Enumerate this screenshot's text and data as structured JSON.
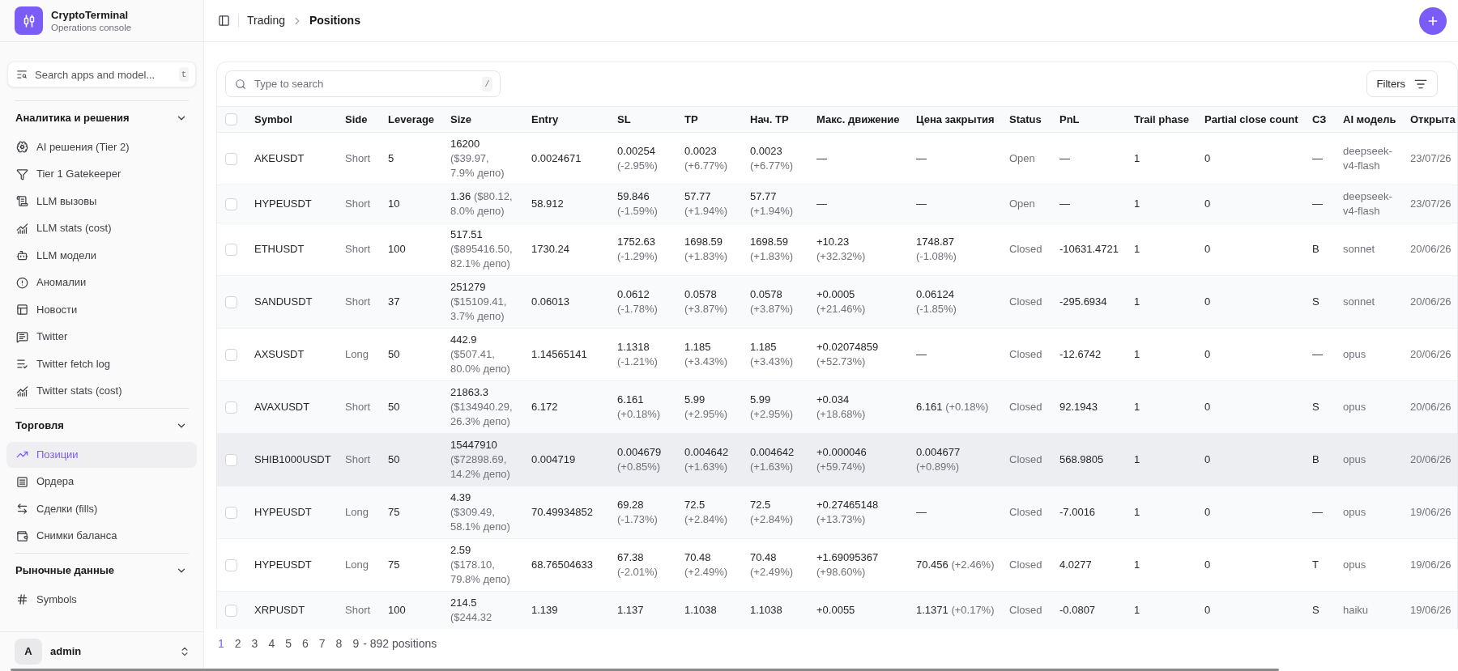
{
  "sidebar": {
    "brand": {
      "title": "CryptoTerminal",
      "subtitle": "Operations console"
    },
    "search": {
      "placeholder": "Search apps and model...",
      "shortcut": "t"
    },
    "sections": [
      {
        "title": "Аналитика и решения",
        "expanded": true,
        "items": [
          {
            "label": "AI решения (Tier 2)",
            "selected": false
          },
          {
            "label": "Tier 1 Gatekeeper",
            "selected": false
          },
          {
            "label": "LLM вызовы",
            "selected": false
          },
          {
            "label": "LLM stats (cost)",
            "selected": false
          },
          {
            "label": "LLM модели",
            "selected": false
          },
          {
            "label": "Аномалии",
            "selected": false
          },
          {
            "label": "Новости",
            "selected": false
          },
          {
            "label": "Twitter",
            "selected": false
          },
          {
            "label": "Twitter fetch log",
            "selected": false
          },
          {
            "label": "Twitter stats (cost)",
            "selected": false
          }
        ]
      },
      {
        "title": "Торговля",
        "expanded": true,
        "items": [
          {
            "label": "Позиции",
            "selected": true
          },
          {
            "label": "Ордера",
            "selected": false
          },
          {
            "label": "Сделки (fills)",
            "selected": false
          },
          {
            "label": "Снимки баланса",
            "selected": false
          }
        ]
      },
      {
        "title": "Рыночные данные",
        "expanded": true,
        "items": [
          {
            "label": "Symbols",
            "selected": false
          }
        ]
      }
    ],
    "user": {
      "initial": "A",
      "name": "admin"
    }
  },
  "header": {
    "breadcrumb": [
      "Trading",
      "Positions"
    ]
  },
  "toolbar": {
    "search": {
      "placeholder": "Type to search",
      "shortcut": "/"
    },
    "filters_button": "Filters"
  },
  "table": {
    "select_all": {
      "checked": false
    },
    "columns": [
      "Symbol",
      "Side",
      "Leverage",
      "Size",
      "Entry",
      "SL",
      "TP",
      "Нач. TP",
      "Макс. движение",
      "Цена закрытия",
      "Status",
      "PnL",
      "Trail phase",
      "Partial close count",
      "СЗ",
      "AI модель",
      "Открыта"
    ],
    "rows": [
      {
        "checked": false,
        "highlighted": false,
        "symbol": "AKEUSDT",
        "side": "Short",
        "leverage": "5",
        "size": {
          "value": "16200",
          "detail": "($39.97, 7.9% депо)"
        },
        "entry": "0.0024671",
        "sl": {
          "value": "0.00254",
          "detail": "(-2.95%)"
        },
        "tp": {
          "value": "0.0023",
          "detail": "(+6.77%)"
        },
        "initial_tp": {
          "value": "0.0023",
          "detail": "(+6.77%)"
        },
        "max_move": {
          "value": "—"
        },
        "close_price": {
          "value": "—"
        },
        "status": "Open",
        "pnl": "—",
        "trail_phase": "1",
        "partial_close_count": "0",
        "sz": "—",
        "ai_model": "deepseek-v4-flash",
        "opened": "23/07/26"
      },
      {
        "checked": false,
        "highlighted": false,
        "symbol": "HYPEUSDT",
        "side": "Short",
        "leverage": "10",
        "size": {
          "value": "1.36",
          "detail": "($80.12, 8.0% депо)"
        },
        "entry": "58.912",
        "sl": {
          "value": "59.846",
          "detail": "(-1.59%)"
        },
        "tp": {
          "value": "57.77",
          "detail": "(+1.94%)"
        },
        "initial_tp": {
          "value": "57.77",
          "detail": "(+1.94%)"
        },
        "max_move": {
          "value": "—"
        },
        "close_price": {
          "value": "—"
        },
        "status": "Open",
        "pnl": "—",
        "trail_phase": "1",
        "partial_close_count": "0",
        "sz": "—",
        "ai_model": "deepseek-v4-flash",
        "opened": "23/07/26"
      },
      {
        "checked": false,
        "highlighted": false,
        "symbol": "ETHUSDT",
        "side": "Short",
        "leverage": "100",
        "size": {
          "value": "517.51",
          "detail": "($895416.50, 82.1% депо)"
        },
        "entry": "1730.24",
        "sl": {
          "value": "1752.63",
          "detail": "(-1.29%)"
        },
        "tp": {
          "value": "1698.59",
          "detail": "(+1.83%)"
        },
        "initial_tp": {
          "value": "1698.59",
          "detail": "(+1.83%)"
        },
        "max_move": {
          "value": "+10.23",
          "detail": "(+32.32%)"
        },
        "close_price": {
          "value": "1748.87",
          "detail": "(-1.08%)"
        },
        "status": "Closed",
        "pnl": "-10631.4721",
        "trail_phase": "1",
        "partial_close_count": "0",
        "sz": "B",
        "ai_model": "sonnet",
        "opened": "20/06/26"
      },
      {
        "checked": false,
        "highlighted": false,
        "symbol": "SANDUSDT",
        "side": "Short",
        "leverage": "37",
        "size": {
          "value": "251279",
          "detail": "($15109.41, 3.7% депо)"
        },
        "entry": "0.06013",
        "sl": {
          "value": "0.0612",
          "detail": "(-1.78%)"
        },
        "tp": {
          "value": "0.0578",
          "detail": "(+3.87%)"
        },
        "initial_tp": {
          "value": "0.0578",
          "detail": "(+3.87%)"
        },
        "max_move": {
          "value": "+0.0005",
          "detail": "(+21.46%)"
        },
        "close_price": {
          "value": "0.06124",
          "detail": "(-1.85%)"
        },
        "status": "Closed",
        "pnl": "-295.6934",
        "trail_phase": "1",
        "partial_close_count": "0",
        "sz": "S",
        "ai_model": "sonnet",
        "opened": "20/06/26"
      },
      {
        "checked": false,
        "highlighted": false,
        "symbol": "AXSUSDT",
        "side": "Long",
        "leverage": "50",
        "size": {
          "value": "442.9",
          "detail": "($507.41, 80.0% депо)"
        },
        "entry": "1.14565141",
        "sl": {
          "value": "1.1318",
          "detail": "(-1.21%)"
        },
        "tp": {
          "value": "1.185",
          "detail": "(+3.43%)"
        },
        "initial_tp": {
          "value": "1.185",
          "detail": "(+3.43%)"
        },
        "max_move": {
          "value": "+0.02074859",
          "detail": "(+52.73%)"
        },
        "close_price": {
          "value": "—"
        },
        "status": "Closed",
        "pnl": "-12.6742",
        "trail_phase": "1",
        "partial_close_count": "0",
        "sz": "—",
        "ai_model": "opus",
        "opened": "20/06/26"
      },
      {
        "checked": false,
        "highlighted": false,
        "symbol": "AVAXUSDT",
        "side": "Short",
        "leverage": "50",
        "size": {
          "value": "21863.3",
          "detail": "($134940.29, 26.3% депо)"
        },
        "entry": "6.172",
        "sl": {
          "value": "6.161",
          "detail": "(+0.18%)"
        },
        "tp": {
          "value": "5.99",
          "detail": "(+2.95%)"
        },
        "initial_tp": {
          "value": "5.99",
          "detail": "(+2.95%)"
        },
        "max_move": {
          "value": "+0.034",
          "detail": "(+18.68%)"
        },
        "close_price": {
          "value": "6.161",
          "detail": "(+0.18%)"
        },
        "status": "Closed",
        "pnl": "92.1943",
        "trail_phase": "1",
        "partial_close_count": "0",
        "sz": "S",
        "ai_model": "opus",
        "opened": "20/06/26"
      },
      {
        "checked": false,
        "highlighted": true,
        "symbol": "SHIB1000USDT",
        "side": "Short",
        "leverage": "50",
        "size": {
          "value": "15447910",
          "detail": "($72898.69, 14.2% депо)"
        },
        "entry": "0.004719",
        "sl": {
          "value": "0.004679",
          "detail": "(+0.85%)"
        },
        "tp": {
          "value": "0.004642",
          "detail": "(+1.63%)"
        },
        "initial_tp": {
          "value": "0.004642",
          "detail": "(+1.63%)"
        },
        "max_move": {
          "value": "+0.000046",
          "detail": "(+59.74%)"
        },
        "close_price": {
          "value": "0.004677",
          "detail": "(+0.89%)"
        },
        "status": "Closed",
        "pnl": "568.9805",
        "trail_phase": "1",
        "partial_close_count": "0",
        "sz": "B",
        "ai_model": "opus",
        "opened": "20/06/26"
      },
      {
        "checked": false,
        "highlighted": false,
        "symbol": "HYPEUSDT",
        "side": "Long",
        "leverage": "75",
        "size": {
          "value": "4.39",
          "detail": "($309.49, 58.1% депо)"
        },
        "entry": "70.49934852",
        "sl": {
          "value": "69.28",
          "detail": "(-1.73%)"
        },
        "tp": {
          "value": "72.5",
          "detail": "(+2.84%)"
        },
        "initial_tp": {
          "value": "72.5",
          "detail": "(+2.84%)"
        },
        "max_move": {
          "value": "+0.27465148",
          "detail": "(+13.73%)"
        },
        "close_price": {
          "value": "—"
        },
        "status": "Closed",
        "pnl": "-7.0016",
        "trail_phase": "1",
        "partial_close_count": "0",
        "sz": "—",
        "ai_model": "opus",
        "opened": "19/06/26"
      },
      {
        "checked": false,
        "highlighted": false,
        "symbol": "HYPEUSDT",
        "side": "Long",
        "leverage": "75",
        "size": {
          "value": "2.59",
          "detail": "($178.10, 79.8% депо)"
        },
        "entry": "68.76504633",
        "sl": {
          "value": "67.38",
          "detail": "(-2.01%)"
        },
        "tp": {
          "value": "70.48",
          "detail": "(+2.49%)"
        },
        "initial_tp": {
          "value": "70.48",
          "detail": "(+2.49%)"
        },
        "max_move": {
          "value": "+1.69095367",
          "detail": "(+98.60%)"
        },
        "close_price": {
          "value": "70.456",
          "detail": "(+2.46%)"
        },
        "status": "Closed",
        "pnl": "4.0277",
        "trail_phase": "1",
        "partial_close_count": "0",
        "sz": "T",
        "ai_model": "opus",
        "opened": "19/06/26"
      },
      {
        "checked": false,
        "highlighted": false,
        "symbol": "XRPUSDT",
        "side": "Short",
        "leverage": "100",
        "size": {
          "value": "214.5",
          "detail": "($244.32"
        },
        "entry": "1.139",
        "sl": {
          "value": "1.137"
        },
        "tp": {
          "value": "1.1038"
        },
        "initial_tp": {
          "value": "1.1038"
        },
        "max_move": {
          "value": "+0.0055"
        },
        "close_price": {
          "value": "1.1371",
          "detail": "(+0.17%)"
        },
        "status": "Closed",
        "pnl": "-0.0807",
        "trail_phase": "1",
        "partial_close_count": "0",
        "sz": "S",
        "ai_model": "haiku",
        "opened": "19/06/26"
      }
    ]
  },
  "pagination": {
    "pages": [
      {
        "label": "1",
        "selected": true
      },
      {
        "label": "2",
        "selected": false
      },
      {
        "label": "3",
        "selected": false
      },
      {
        "label": "4",
        "selected": false
      },
      {
        "label": "5",
        "selected": false
      },
      {
        "label": "6",
        "selected": false
      },
      {
        "label": "7",
        "selected": false
      },
      {
        "label": "8",
        "selected": false
      },
      {
        "label": "9",
        "selected": false
      }
    ],
    "summary": "- 892 positions"
  }
}
